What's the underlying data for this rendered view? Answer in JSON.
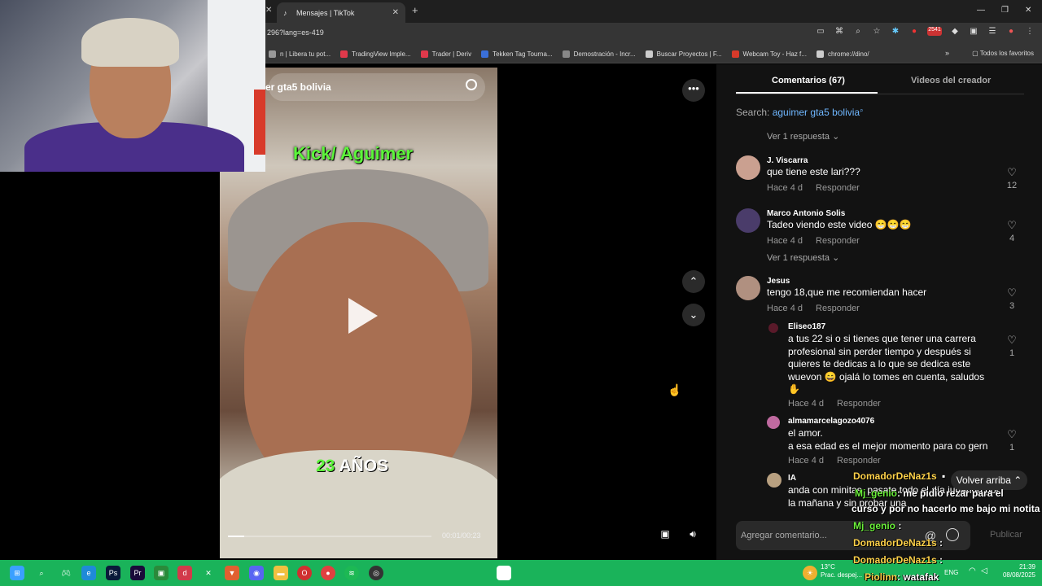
{
  "browser": {
    "tab_title": "Mensajes | TikTok",
    "url": "296?lang=es-419",
    "bookmarks": [
      {
        "label": "n | Libera tu pot...",
        "color": "#999999"
      },
      {
        "label": "TradingView Imple...",
        "color": "#e0394b"
      },
      {
        "label": "Trader | Deriv",
        "color": "#e0394b"
      },
      {
        "label": "Tekken Tag Tourna...",
        "color": "#3a6fd8"
      },
      {
        "label": "Demostración - Incr...",
        "color": "#888888"
      },
      {
        "label": "Buscar Proyectos | F...",
        "color": "#cccccc"
      },
      {
        "label": "Webcam Toy - Haz f...",
        "color": "#d83a2a"
      },
      {
        "label": "chrome://dino/",
        "color": "#cccccc"
      }
    ],
    "all_bookmarks": "Todos los favoritos",
    "extension_badge": "2541"
  },
  "video": {
    "search_query": "er gta5 bolivia",
    "overlay_top": "Kick/ Aguimer",
    "overlay_age_num": "23",
    "overlay_age_word": "AÑOS",
    "time": "00:01/00:23",
    "progress": 0.08
  },
  "panel": {
    "tab_comments": "Comentarios (67)",
    "tab_creator": "Videos del creador",
    "search_prefix": "Search: ",
    "search_keyword": "aguimer gta5 bolivia",
    "view_reply": "Ver 1 respuesta ⌄",
    "comments": [
      {
        "user": "J. Viscarra",
        "text": "que tiene este lari???",
        "time": "Hace 4 d",
        "reply": "Responder",
        "likes": "12"
      },
      {
        "user": "Marco Antonio Solis",
        "text": "Tadeo viendo este video 😁😁😁",
        "time": "Hace 4 d",
        "reply": "Responder",
        "likes": "4"
      },
      {
        "user": "Jesus",
        "text": "tengo 18,que me recomiendan hacer",
        "time": "Hace 4 d",
        "reply": "Responder",
        "likes": "3"
      },
      {
        "user": "Eliseo187",
        "text": "a tus 22 si o si tienes que tener una carrera profesional sin perder tiempo y después si quieres te dedicas a lo que se dedica este wuevon 😄 ojalá lo tomes en cuenta, saludos ✋",
        "time": "Hace 4 d",
        "reply": "Responder",
        "likes": "1"
      },
      {
        "user": "almamarcelagozo4076",
        "text": "el amor.\na esa edad es el mejor momento para co gern",
        "time": "Hace 4 d",
        "reply": "Responder",
        "likes": "1"
      },
      {
        "user": "IA",
        "text": "anda con minitas, pasate todo el día jugando por la mañana y sin probar una",
        "time": "",
        "reply": "",
        "likes": "0"
      }
    ],
    "back_to_top": "Volver arriba ⌃",
    "add_comment": "Agregar comentario...",
    "publish": "Publicar"
  },
  "chat": [
    {
      "user": "DomadorDeNaz1s",
      "msg": "",
      "color": "u1"
    },
    {
      "user": "Mj_genio",
      "msg": ": me pidio rezar para el",
      "color": "u2"
    },
    {
      "user": "",
      "msg": "curso y por no hacerlo me bajo mi notita",
      "color": ""
    },
    {
      "user": "Mj_genio",
      "msg": ":",
      "color": "u2"
    },
    {
      "user": "DomadorDeNaz1s",
      "msg": ":",
      "color": "u1"
    },
    {
      "user": "DomadorDeNaz1s",
      "msg": ":",
      "color": "u1"
    },
    {
      "user": "Piolinn",
      "msg": ": watafak",
      "color": "u1"
    }
  ],
  "taskbar": {
    "weather": "13°C",
    "weather_desc": "Prac. despej...",
    "lang": "ENG",
    "time": "21:39",
    "date": "08/08/2025"
  }
}
